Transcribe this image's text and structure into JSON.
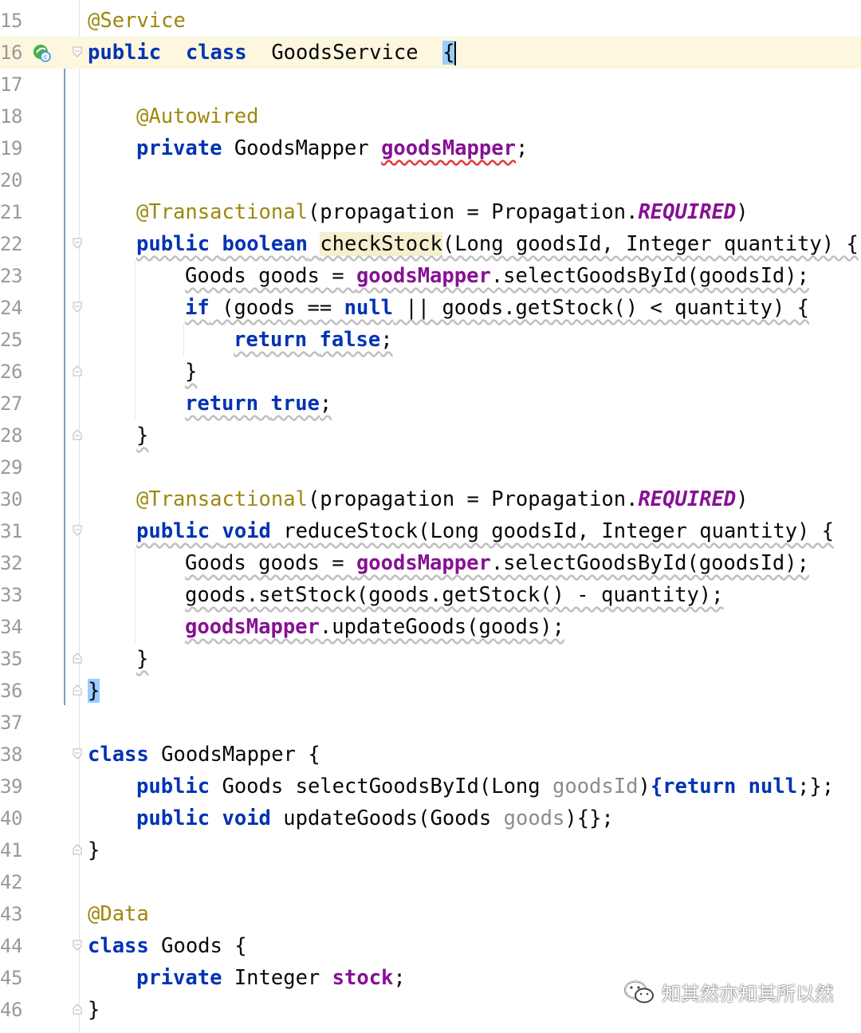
{
  "editor": {
    "lines": [
      {
        "num": "15",
        "tokens": [
          [
            "ann",
            "@Service"
          ]
        ]
      },
      {
        "num": "16",
        "current": true,
        "tokens": [
          [
            "kw",
            "public"
          ],
          [
            "",
            "  "
          ],
          [
            "kw",
            "class"
          ],
          [
            "",
            "  GoodsService  "
          ],
          [
            "brace",
            "{"
          ]
        ]
      },
      {
        "num": "17",
        "tokens": []
      },
      {
        "num": "18",
        "indent": 1,
        "tokens": [
          [
            "ann",
            "@Autowired"
          ]
        ]
      },
      {
        "num": "19",
        "indent": 1,
        "tokens": [
          [
            "kw",
            "private"
          ],
          [
            "",
            " GoodsMapper "
          ],
          [
            "fld err",
            "goodsMapper"
          ],
          [
            "",
            ";"
          ]
        ]
      },
      {
        "num": "20",
        "tokens": []
      },
      {
        "num": "21",
        "indent": 1,
        "tokens": [
          [
            "ann",
            "@Transactional"
          ],
          [
            "",
            "(propagation = Propagation."
          ],
          [
            "const",
            "REQUIRED"
          ],
          [
            "",
            ")"
          ]
        ]
      },
      {
        "num": "22",
        "indent": 1,
        "tokens": [
          [
            "kw",
            "public"
          ],
          [
            "",
            " "
          ],
          [
            "kw",
            "boolean"
          ],
          [
            "",
            " "
          ],
          [
            "hl",
            "checkStock"
          ],
          [
            "",
            "(Long goodsId, Integer quantity) {"
          ]
        ]
      },
      {
        "num": "23",
        "indent": 2,
        "tokens": [
          [
            "",
            "Goods goods = "
          ],
          [
            "fld",
            "goodsMapper"
          ],
          [
            "",
            ".selectGoodsById(goodsId);"
          ]
        ]
      },
      {
        "num": "24",
        "indent": 2,
        "tokens": [
          [
            "kw",
            "if"
          ],
          [
            "",
            " (goods == "
          ],
          [
            "kw",
            "null"
          ],
          [
            "",
            " || goods.getStock() < quantity) {"
          ]
        ]
      },
      {
        "num": "25",
        "indent": 3,
        "tokens": [
          [
            "kw",
            "return"
          ],
          [
            "",
            " "
          ],
          [
            "kw",
            "false"
          ],
          [
            "",
            ";"
          ]
        ]
      },
      {
        "num": "26",
        "indent": 2,
        "tokens": [
          [
            "",
            "}"
          ]
        ]
      },
      {
        "num": "27",
        "indent": 2,
        "tokens": [
          [
            "kw",
            "return"
          ],
          [
            "",
            " "
          ],
          [
            "kw",
            "true"
          ],
          [
            "",
            ";"
          ]
        ]
      },
      {
        "num": "28",
        "indent": 1,
        "tokens": [
          [
            "",
            "}"
          ]
        ]
      },
      {
        "num": "29",
        "tokens": []
      },
      {
        "num": "30",
        "indent": 1,
        "tokens": [
          [
            "ann",
            "@Transactional"
          ],
          [
            "",
            "(propagation = Propagation."
          ],
          [
            "const",
            "REQUIRED"
          ],
          [
            "",
            ")"
          ]
        ]
      },
      {
        "num": "31",
        "indent": 1,
        "tokens": [
          [
            "kw",
            "public"
          ],
          [
            "",
            " "
          ],
          [
            "kw",
            "void"
          ],
          [
            "",
            " reduceStock(Long goodsId, Integer quantity) {"
          ]
        ]
      },
      {
        "num": "32",
        "indent": 2,
        "tokens": [
          [
            "",
            "Goods goods = "
          ],
          [
            "fld",
            "goodsMapper"
          ],
          [
            "",
            ".selectGoodsById(goodsId);"
          ]
        ]
      },
      {
        "num": "33",
        "indent": 2,
        "tokens": [
          [
            "",
            "goods.setStock(goods.getStock() - quantity);"
          ]
        ]
      },
      {
        "num": "34",
        "indent": 2,
        "tokens": [
          [
            "fld",
            "goodsMapper"
          ],
          [
            "",
            ".updateGoods(goods);"
          ]
        ]
      },
      {
        "num": "35",
        "indent": 1,
        "tokens": [
          [
            "",
            "}"
          ]
        ]
      },
      {
        "num": "36",
        "tokens": [
          [
            "brace",
            "}"
          ]
        ]
      },
      {
        "num": "37",
        "tokens": []
      },
      {
        "num": "38",
        "tokens": [
          [
            "kw",
            "class"
          ],
          [
            "",
            " GoodsMapper {"
          ]
        ]
      },
      {
        "num": "39",
        "indent": 1,
        "tokens": [
          [
            "kw",
            "public"
          ],
          [
            "",
            " Goods selectGoodsById(Long "
          ],
          [
            "param",
            "goodsId"
          ],
          [
            "",
            ")"
          ],
          [
            "kw",
            "{return"
          ],
          [
            "",
            " "
          ],
          [
            "kw",
            "null"
          ],
          [
            "",
            ";};"
          ]
        ]
      },
      {
        "num": "40",
        "indent": 1,
        "tokens": [
          [
            "kw",
            "public"
          ],
          [
            "",
            " "
          ],
          [
            "kw",
            "void"
          ],
          [
            "",
            " updateGoods(Goods "
          ],
          [
            "param",
            "goods"
          ],
          [
            "",
            "){};"
          ]
        ]
      },
      {
        "num": "41",
        "tokens": [
          [
            "",
            "}"
          ]
        ]
      },
      {
        "num": "42",
        "tokens": []
      },
      {
        "num": "43",
        "tokens": [
          [
            "ann",
            "@Data"
          ]
        ]
      },
      {
        "num": "44",
        "tokens": [
          [
            "kw",
            "class"
          ],
          [
            "",
            " Goods {"
          ]
        ]
      },
      {
        "num": "45",
        "indent": 1,
        "tokens": [
          [
            "kw",
            "private"
          ],
          [
            "",
            " Integer "
          ],
          [
            "fld",
            "stock"
          ],
          [
            "",
            ";"
          ]
        ]
      },
      {
        "num": "46",
        "tokens": [
          [
            "",
            "}"
          ]
        ]
      }
    ],
    "fold_lines": [
      "16",
      "22",
      "24",
      "26",
      "28",
      "31",
      "35",
      "36",
      "38",
      "41",
      "44",
      "46"
    ],
    "wavy_lines": [
      "22",
      "23",
      "24",
      "25",
      "26",
      "27",
      "28",
      "31",
      "32",
      "33",
      "34",
      "35"
    ],
    "run_icon_line": "16",
    "run_icon": "spring-bean-icon"
  },
  "watermark": {
    "icon": "wechat-icon",
    "text": "知其然亦知其所以然"
  },
  "colors": {
    "keyword": "#0033b3",
    "annotation": "#9e880d",
    "field": "#871094",
    "current_line": "#fcf7de",
    "brace_match": "#99ccff"
  }
}
